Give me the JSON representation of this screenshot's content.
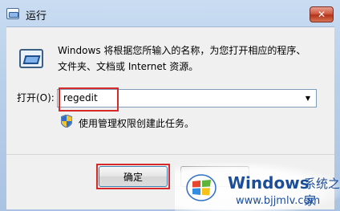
{
  "window": {
    "title": "运行",
    "close_glyph": "✕"
  },
  "dialog": {
    "description_lines": [
      "Windows 将根据您所输入的名称，为您打开相应的程序、",
      "文件夹、文档或 Internet 资源。"
    ],
    "open_label": "打开(O):",
    "input_value": "regedit",
    "dropdown_arrow": "▼",
    "admin_note": "使用管理权限创建此任务。",
    "ok_label": "确定",
    "cancel_label": ""
  },
  "watermark": {
    "brand": "Windows",
    "cn": "系统之家",
    "url": "www.bjjmlv.com"
  },
  "colors": {
    "highlight": "#d62a2a",
    "title_bar": "#b8cfe9",
    "brand_blue": "#1b4d9a"
  },
  "icons": [
    "run-icon",
    "shield-icon",
    "close-icon",
    "windows-logo-icon"
  ]
}
